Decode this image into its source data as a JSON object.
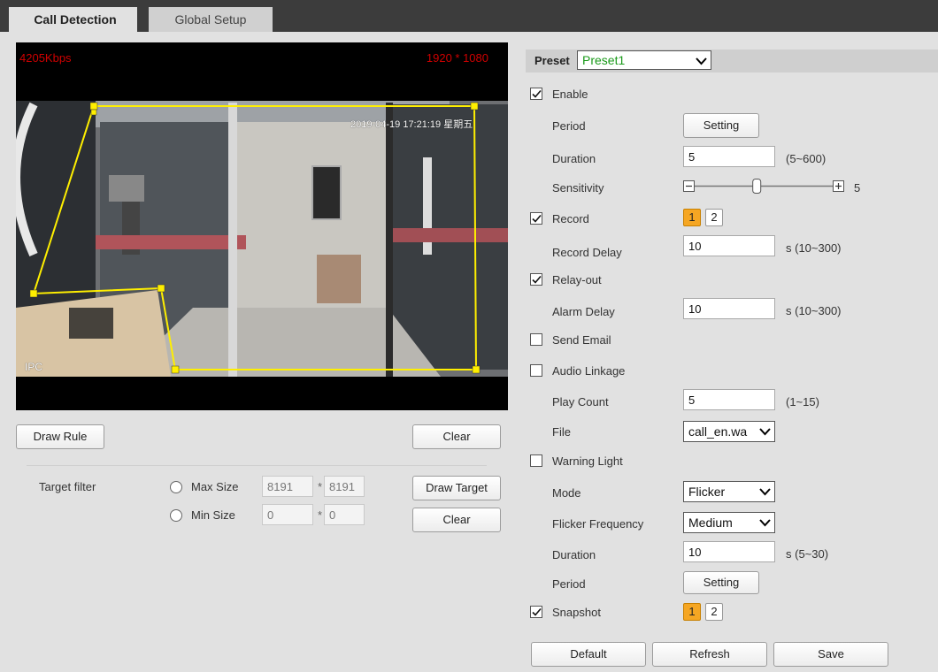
{
  "tabs": [
    {
      "label": "Call Detection",
      "active": true
    },
    {
      "label": "Global Setup",
      "active": false
    }
  ],
  "video": {
    "bitrate": "4205Kbps",
    "resolution": "1920 * 1080",
    "timestamp": "2019-04-19 17:21:19 星期五",
    "channel_label": "IPC"
  },
  "left": {
    "draw_rule": "Draw Rule",
    "clear": "Clear",
    "target_filter_label": "Target filter",
    "max_size_label": "Max Size",
    "max_w": "8191",
    "max_h": "8191",
    "min_size_label": "Min Size",
    "min_w": "0",
    "min_h": "0",
    "times": "*",
    "draw_target": "Draw Target",
    "clear2": "Clear"
  },
  "right": {
    "preset_label": "Preset",
    "preset_value": "Preset1",
    "enable": "Enable",
    "period": "Period",
    "setting": "Setting",
    "duration": "Duration",
    "duration_value": "5",
    "duration_hint": "(5~600)",
    "sensitivity": "Sensitivity",
    "sensitivity_value": "5",
    "sensitivity_level": 0.45,
    "record": "Record",
    "record_streams": [
      "1",
      "2"
    ],
    "record_delay": "Record Delay",
    "record_delay_value": "10",
    "record_delay_hint": "s (10~300)",
    "relay_out": "Relay-out",
    "alarm_delay": "Alarm Delay",
    "alarm_delay_value": "10",
    "alarm_delay_hint": "s (10~300)",
    "send_email": "Send Email",
    "audio_linkage": "Audio Linkage",
    "play_count": "Play Count",
    "play_count_value": "5",
    "play_count_hint": "(1~15)",
    "file": "File",
    "file_value": "call_en.wa",
    "warning_light": "Warning Light",
    "mode": "Mode",
    "mode_value": "Flicker",
    "flicker_frequency": "Flicker Frequency",
    "flicker_value": "Medium",
    "duration2": "Duration",
    "duration2_value": "10",
    "duration2_hint": "s (5~30)",
    "period2": "Period",
    "setting2": "Setting",
    "snapshot": "Snapshot",
    "snapshot_streams": [
      "1",
      "2"
    ]
  },
  "footer": {
    "default": "Default",
    "refresh": "Refresh",
    "save": "Save"
  },
  "colors": {
    "accent_orange": "#f5a623",
    "rule_yellow": "#ffef00",
    "preset_green": "#1a9a1a",
    "overlay_red": "#d00000"
  }
}
